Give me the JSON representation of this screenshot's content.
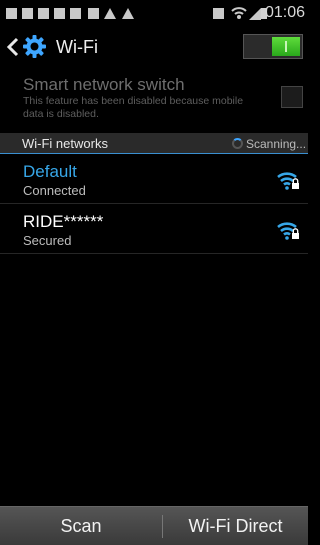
{
  "status_bar": {
    "time": "01:06"
  },
  "action_bar": {
    "title": "Wi-Fi",
    "wifi_enabled": true
  },
  "smart_network": {
    "title": "Smart network switch",
    "description": "This feature has been disabled because mobile data is disabled.",
    "checked": false
  },
  "networks_section": {
    "title": "Wi-Fi networks",
    "scanning_label": "Scanning..."
  },
  "networks": [
    {
      "name": "Default",
      "status": "Connected",
      "icon": "wifi-lock-icon"
    },
    {
      "name": "RIDE******",
      "status": "Secured",
      "icon": "wifi-lock-icon"
    }
  ],
  "bottom_bar": {
    "scan_label": "Scan",
    "direct_label": "Wi-Fi Direct"
  },
  "colors": {
    "accent": "#37a7e8",
    "toggle_on": "#3fc22a"
  }
}
